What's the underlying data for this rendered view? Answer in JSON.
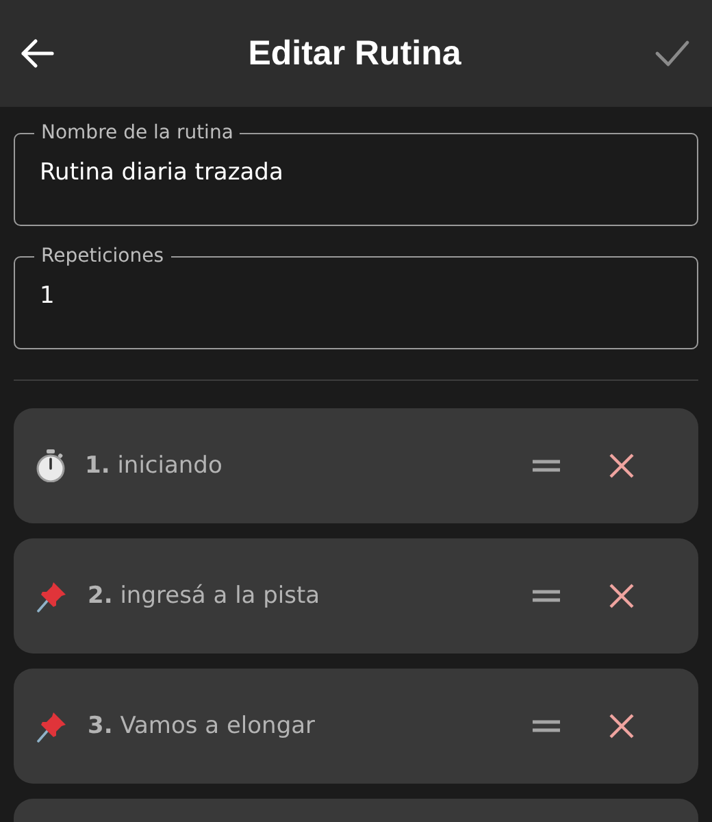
{
  "header": {
    "title": "Editar Rutina"
  },
  "fields": [
    {
      "label": "Nombre de la rutina",
      "value": "Rutina diaria trazada"
    },
    {
      "label": "Repeticiones",
      "value": "1"
    }
  ],
  "steps": [
    {
      "kind": "timer",
      "label": "**1.** iniciando"
    },
    {
      "kind": "pin",
      "label": "**2.** ingresá a la pista"
    },
    {
      "kind": "pin",
      "label": "**3.** Vamos a elongar"
    }
  ]
}
